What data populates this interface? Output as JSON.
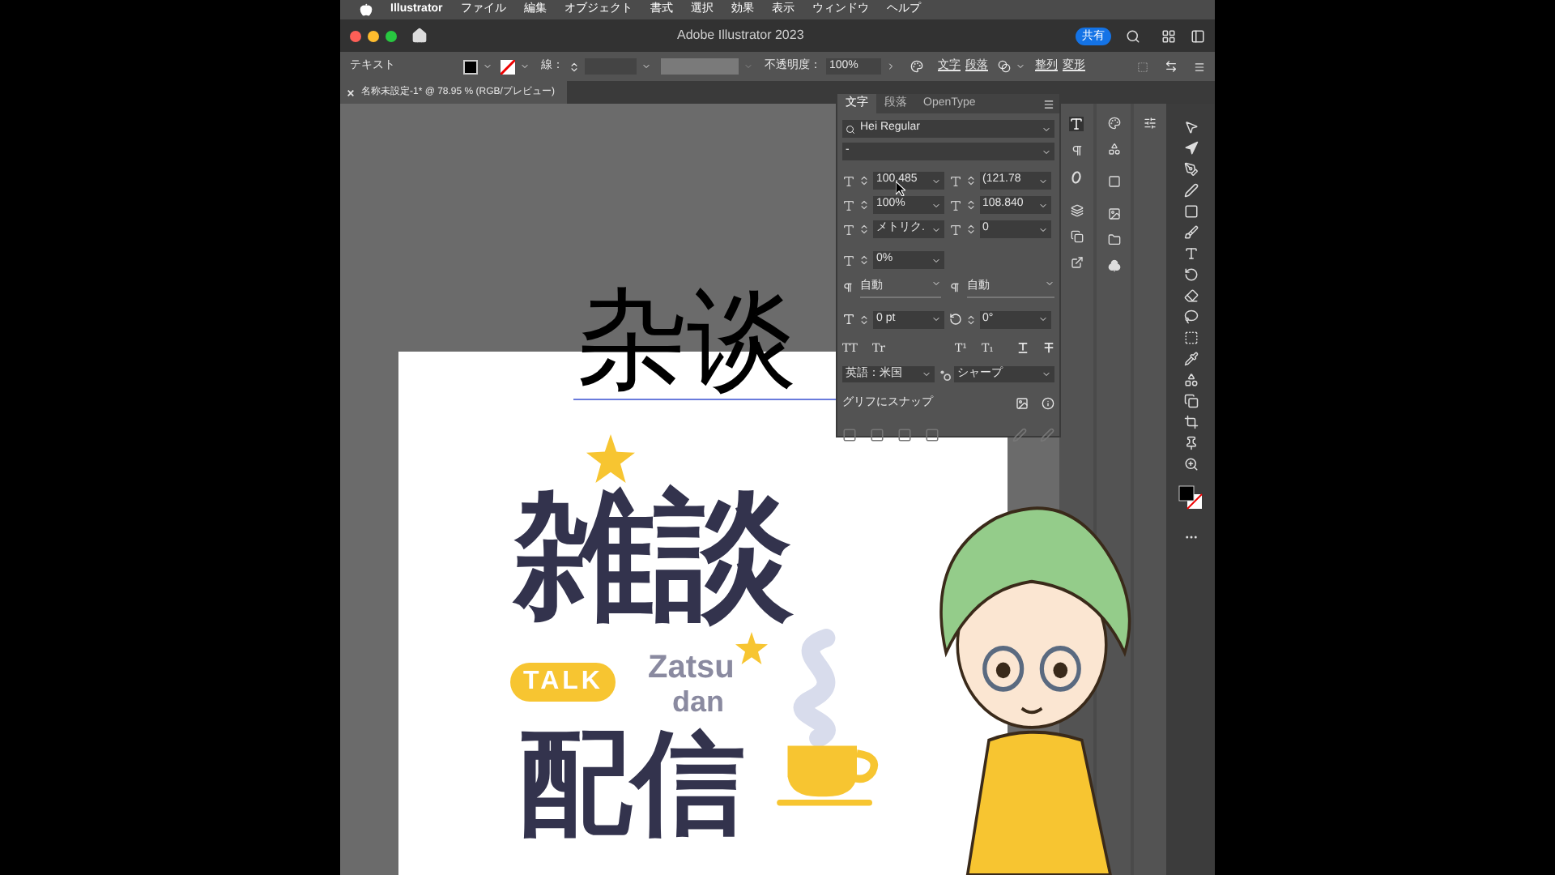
{
  "menu_bar": {
    "app": "Illustrator",
    "items": [
      "ファイル",
      "編集",
      "オブジェクト",
      "書式",
      "選択",
      "効果",
      "表示",
      "ウィンドウ",
      "ヘルプ"
    ]
  },
  "title_bar": {
    "title": "Adobe Illustrator 2023",
    "share": "共有"
  },
  "control_bar": {
    "label": "テキスト",
    "stroke_label": "線：",
    "opacity_label": "不透明度：",
    "opacity": "100%",
    "links": [
      "文字",
      "段落",
      "整列",
      "変形"
    ]
  },
  "document_tab": {
    "title": "名称未設定-1* @ 78.95 % (RGB/プレビュー)"
  },
  "character_panel": {
    "tabs": [
      {
        "label": "文字",
        "selected": true
      },
      {
        "label": "段落",
        "selected": false
      },
      {
        "label": "OpenType",
        "selected": false
      }
    ],
    "font_family": "Hei Regular",
    "font_style": "-",
    "fields": [
      {
        "value": "100.485"
      },
      {
        "value": "(121.78"
      },
      {
        "value": "100%"
      },
      {
        "value": "108.840"
      },
      {
        "value": "メトリク."
      },
      {
        "value": "0"
      }
    ],
    "tracking": "0%",
    "before": "自動",
    "after": "自動",
    "baseline": "0 pt",
    "rotation": "0°",
    "styles": [
      "TT",
      "Tr",
      "T¹",
      "T₁"
    ],
    "language": "英語：米国",
    "antialias": "シャープ",
    "snap_label": "グリフにスナップ"
  },
  "canvas": {
    "heading": "杂谈",
    "logo": {
      "title": "雑談",
      "badge": "TALK",
      "romaji": [
        "Zatsu",
        "dan"
      ],
      "subtitle": "配信"
    }
  }
}
